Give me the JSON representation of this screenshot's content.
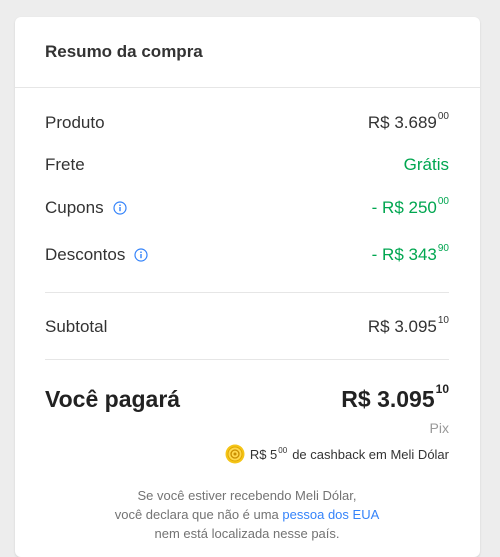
{
  "summary": {
    "title": "Resumo da compra",
    "product": {
      "label": "Produto",
      "amount": "R$ 3.689",
      "cents": "00"
    },
    "shipping": {
      "label": "Frete",
      "value": "Grátis"
    },
    "coupons": {
      "label": "Cupons",
      "amount": "- R$ 250",
      "cents": "00"
    },
    "discounts": {
      "label": "Descontos",
      "amount": "- R$ 343",
      "cents": "90"
    },
    "subtotal": {
      "label": "Subtotal",
      "amount": "R$ 3.095",
      "cents": "10"
    },
    "total": {
      "label": "Você pagará",
      "amount": "R$ 3.095",
      "cents": "10",
      "method": "Pix"
    },
    "cashback": {
      "amount": "R$ 5",
      "cents": "00",
      "text": "de cashback em Meli Dólar"
    },
    "disclaimer": {
      "line1": "Se você estiver recebendo Meli Dólar,",
      "line2_prefix": "você declara que não é uma",
      "line2_link": "pessoa dos EUA",
      "line3": "nem está localizada nesse país."
    }
  },
  "colors": {
    "accent_green": "#00a650",
    "link_blue": "#3483fa",
    "info_icon": "#3483fa",
    "coin": "#f5c518"
  },
  "icons": {
    "info": "info-icon",
    "coin": "meli-dolar-coin-icon"
  }
}
